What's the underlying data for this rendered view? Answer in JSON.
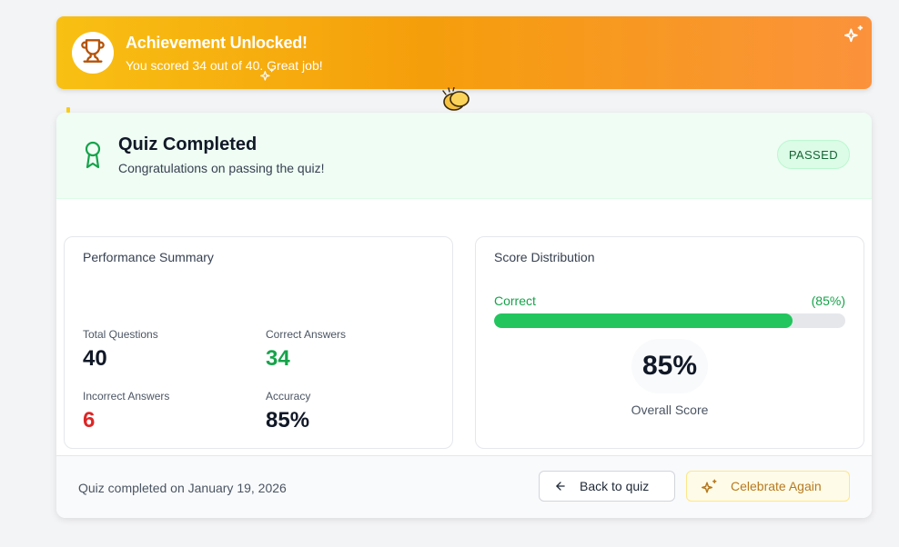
{
  "banner": {
    "title": "Achievement Unlocked!",
    "message": "You scored 34 out of 40. Great job!",
    "gradient_start": "#f8c013",
    "gradient_end": "#fb923c",
    "icon": "trophy-icon"
  },
  "card_header": {
    "title": "Quiz Completed",
    "subtitle": "Congratulations on passing the quiz!",
    "status_badge": "PASSED",
    "icon": "award-icon",
    "accent_color": "#16a34a"
  },
  "performance": {
    "title": "Performance Summary",
    "stats": [
      {
        "label": "Total Questions",
        "value": "40",
        "color": "#111827"
      },
      {
        "label": "Correct Answers",
        "value": "34",
        "color": "#16a34a"
      },
      {
        "label": "Incorrect Answers",
        "value": "6",
        "color": "#dc2626"
      },
      {
        "label": "Accuracy",
        "value": "85%",
        "color": "#111827"
      }
    ]
  },
  "distribution": {
    "title": "Score Distribution",
    "bar_label": "Correct",
    "bar_percent_text": "(85%)",
    "bar_fraction": 0.85,
    "score": "85%",
    "score_label": "Overall Score"
  },
  "footer": {
    "completed_text": "Quiz completed on January 19, 2026",
    "back_button": "Back to quiz",
    "celebrate_button": "Celebrate Again"
  }
}
